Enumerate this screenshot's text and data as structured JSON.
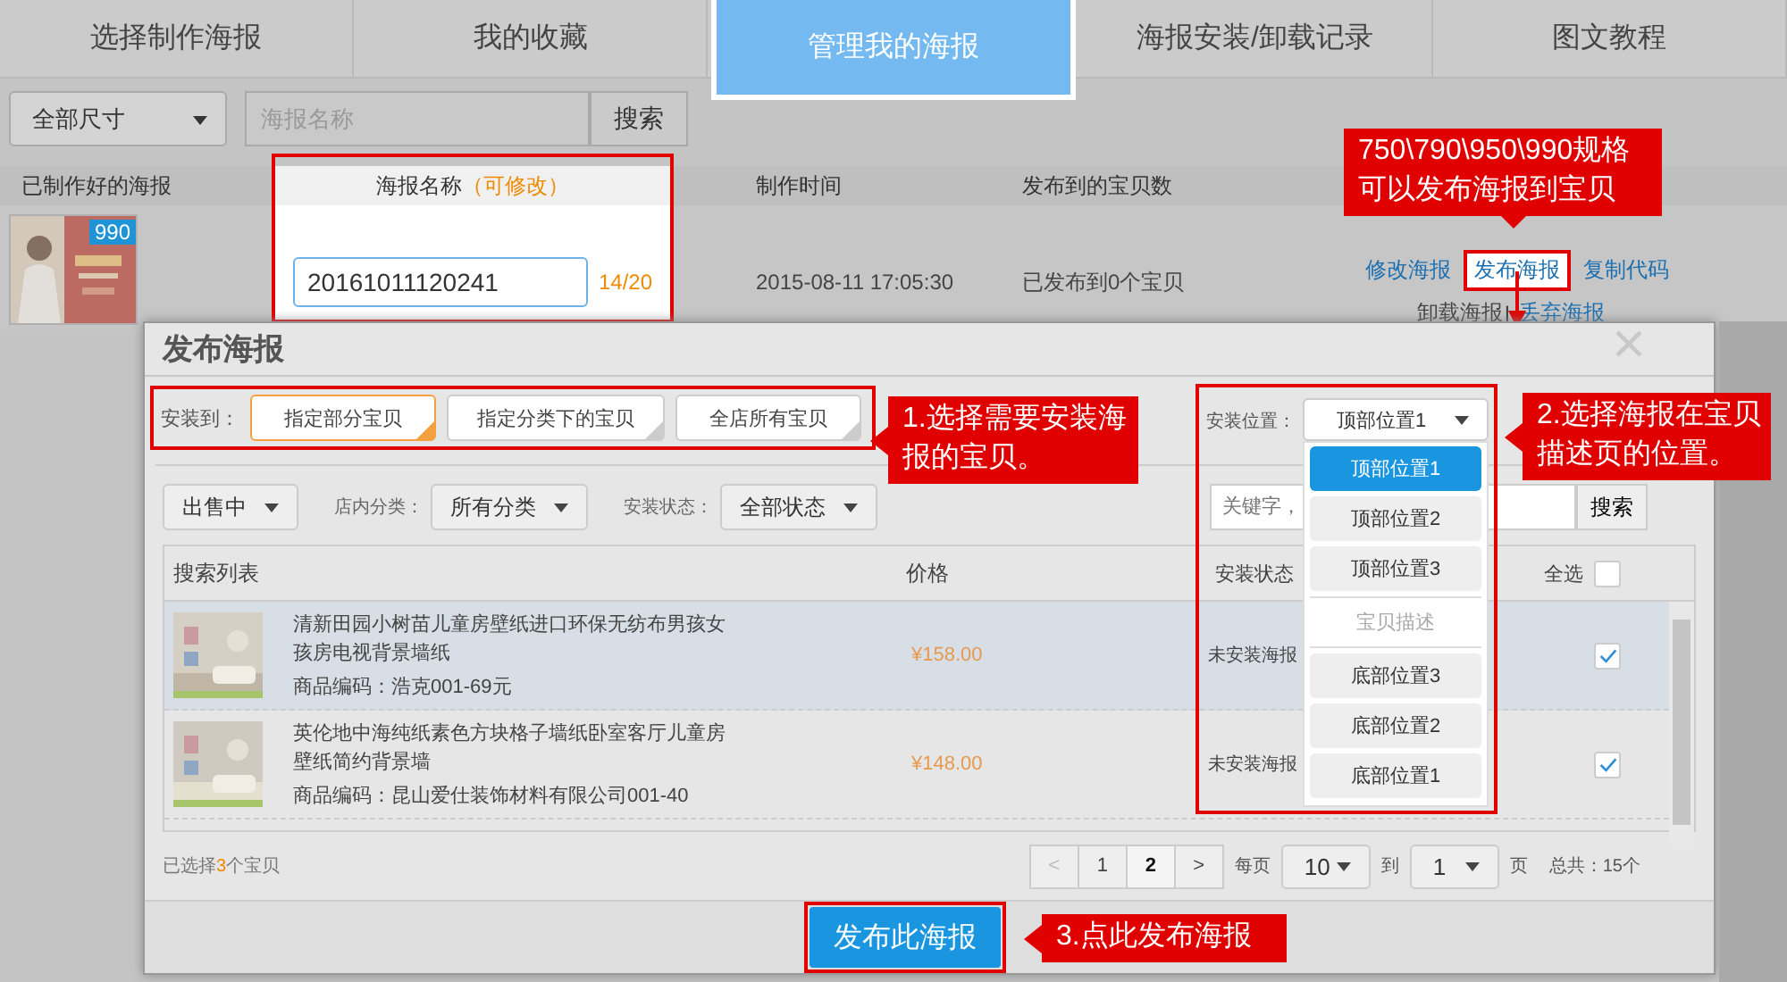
{
  "tabs": [
    {
      "label": "选择制作海报",
      "selected": false
    },
    {
      "label": "我的收藏",
      "selected": false
    },
    {
      "label": "管理我的海报",
      "selected": true
    },
    {
      "label": "海报安装/卸载记录",
      "selected": false
    },
    {
      "label": "图文教程",
      "selected": false
    }
  ],
  "toolbar": {
    "size_filter": "全部尺寸",
    "search": {
      "placeholder": "海报名称"
    },
    "search_button": "搜索"
  },
  "poster_table": {
    "columns": [
      {
        "label": "已制作好的海报"
      },
      {
        "label": "海报名称",
        "note": "（可修改）"
      },
      {
        "label": "制作时间"
      },
      {
        "label": "发布到的宝贝数"
      }
    ],
    "rows": [
      {
        "badge": "990",
        "name": "20161011120241",
        "name_count": "14/20",
        "created": "2015-08-11 17:05:30",
        "published": "已发布到0个宝贝",
        "actions": [
          {
            "label": "修改海报",
            "highlighted": false,
            "disabled": false
          },
          {
            "label": "发布海报",
            "highlighted": true,
            "disabled": false
          },
          {
            "label": "复制代码",
            "highlighted": false,
            "disabled": false
          }
        ],
        "more_actions": [
          {
            "label": "卸载海报",
            "highlighted": false,
            "disabled": true
          },
          {
            "label": "丢弃海报",
            "highlighted": false,
            "disabled": false
          }
        ],
        "separator": "|"
      }
    ]
  },
  "dialog": {
    "title": "发布海报",
    "install_to": {
      "label": "安装到：",
      "options": [
        {
          "label": "指定部分宝贝",
          "selected": true
        },
        {
          "label": "指定分类下的宝贝",
          "selected": false
        },
        {
          "label": "全店所有宝贝",
          "selected": false
        }
      ]
    },
    "position": {
      "label": "安装位置：",
      "value": "顶部位置1",
      "options": [
        {
          "label": "顶部位置1",
          "kind": "option",
          "selected": true
        },
        {
          "label": "顶部位置2",
          "kind": "option",
          "selected": false
        },
        {
          "label": "顶部位置3",
          "kind": "option",
          "selected": false
        },
        {
          "label": "宝贝描述",
          "kind": "divider",
          "selected": false
        },
        {
          "label": "底部位置3",
          "kind": "option",
          "selected": false
        },
        {
          "label": "底部位置2",
          "kind": "option",
          "selected": false
        },
        {
          "label": "底部位置1",
          "kind": "option",
          "selected": false
        }
      ]
    },
    "filters": {
      "status": "出售中",
      "category_label": "店内分类：",
      "category": "所有分类",
      "install_state_label": "安装状态：",
      "install_state": "全部状态",
      "keyword": {
        "placeholder": "关键字，"
      },
      "search_button": "搜索"
    },
    "table": {
      "columns": [
        {
          "label": "搜索列表"
        },
        {
          "label": "价格"
        },
        {
          "label": "安装状态"
        },
        {
          "label": "全选"
        }
      ],
      "select_all_checked": false,
      "rows": [
        {
          "title": "清新田园小树苗儿童房壁纸进口环保无纺布男孩女孩房电视背景墙纸",
          "code": "商品编码：浩克001-69元",
          "price": "¥158.00",
          "status": "未安装海报",
          "checked": true,
          "selected": true
        },
        {
          "title": "英伦地中海纯纸素色方块格子墙纸卧室客厅儿童房壁纸简约背景墙",
          "code": "商品编码：昆山爱仕装饰材料有限公司001-40",
          "price": "¥148.00",
          "status": "未安装海报",
          "checked": true,
          "selected": false
        }
      ]
    },
    "footer": {
      "selected_prefix": "已选择",
      "selected_count": "3",
      "selected_suffix": "个宝贝",
      "pages": [
        {
          "label": "<",
          "selected": false,
          "disabled": true
        },
        {
          "label": "1",
          "selected": false,
          "disabled": false
        },
        {
          "label": "2",
          "selected": true,
          "disabled": false
        },
        {
          "label": ">",
          "selected": false,
          "disabled": false
        }
      ],
      "per_page_label": "每页",
      "per_page": "10",
      "goto_label": "到",
      "goto": "1",
      "page_label": "页",
      "total": "总共：15个"
    },
    "publish_button": "发布此海报"
  },
  "callouts": [
    {
      "kind": "down",
      "lines": [
        "750\\790\\950\\990规格",
        "可以发布海报到宝贝"
      ]
    },
    {
      "kind": "left",
      "lines": [
        "1.选择需要安装海",
        "报的宝贝。"
      ]
    },
    {
      "kind": "left",
      "lines": [
        "2.选择海报在宝贝",
        "描述页的位置。"
      ]
    },
    {
      "kind": "left",
      "lines": [
        "3.点此发布海报"
      ]
    }
  ]
}
